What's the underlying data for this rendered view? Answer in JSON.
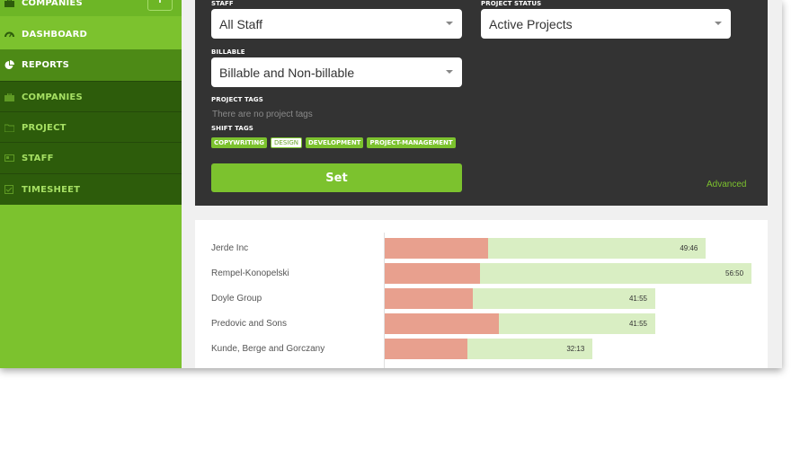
{
  "sidebar": {
    "items": [
      {
        "label": "COMPANIES",
        "icon": "briefcase-icon"
      },
      {
        "label": "DASHBOARD",
        "icon": "gauge-icon"
      },
      {
        "label": "REPORTS",
        "icon": "pie-chart-icon"
      },
      {
        "label": "COMPANIES",
        "icon": "briefcase-icon"
      },
      {
        "label": "PROJECT",
        "icon": "folder-icon"
      },
      {
        "label": "STAFF",
        "icon": "id-card-icon"
      },
      {
        "label": "TIMESHEET",
        "icon": "checklist-icon"
      }
    ],
    "add_label": "+"
  },
  "filters": {
    "staff_label": "STAFF",
    "staff_value": "All Staff",
    "project_status_label": "PROJECT STATUS",
    "project_status_value": "Active Projects",
    "billable_label": "BILLABLE",
    "billable_value": "Billable and Non-billable",
    "project_tags_label": "PROJECT TAGS",
    "project_tags_empty": "There are no project tags",
    "shift_tags_label": "SHIFT TAGS",
    "shift_tags": [
      "COPYWRITING",
      "DESIGN",
      "DEVELOPMENT",
      "PROJECT-MANAGEMENT"
    ],
    "set_label": "Set",
    "advanced_label": "Advanced"
  },
  "colors": {
    "brand_green": "#7cc22e",
    "dark_panel": "#333333",
    "billable_bar": "#e8a08e",
    "total_bar": "#d9eec3"
  },
  "chart_data": {
    "type": "bar",
    "orientation": "horizontal",
    "categories": [
      "Jerde Inc",
      "Rempel-Konopelski",
      "Doyle Group",
      "Predovic and Sons",
      "Kunde, Berge and Gorczany"
    ],
    "series": [
      {
        "values": [
          16.0,
          14.7,
          13.7,
          17.7,
          12.8
        ]
      },
      {
        "values": [
          49.77,
          56.83,
          41.92,
          41.92,
          32.22
        ]
      }
    ],
    "value_labels": [
      "49:46",
      "56:50",
      "41:55",
      "41:55",
      "32:13"
    ],
    "xlim": [
      0,
      56.83
    ],
    "grid": false
  }
}
